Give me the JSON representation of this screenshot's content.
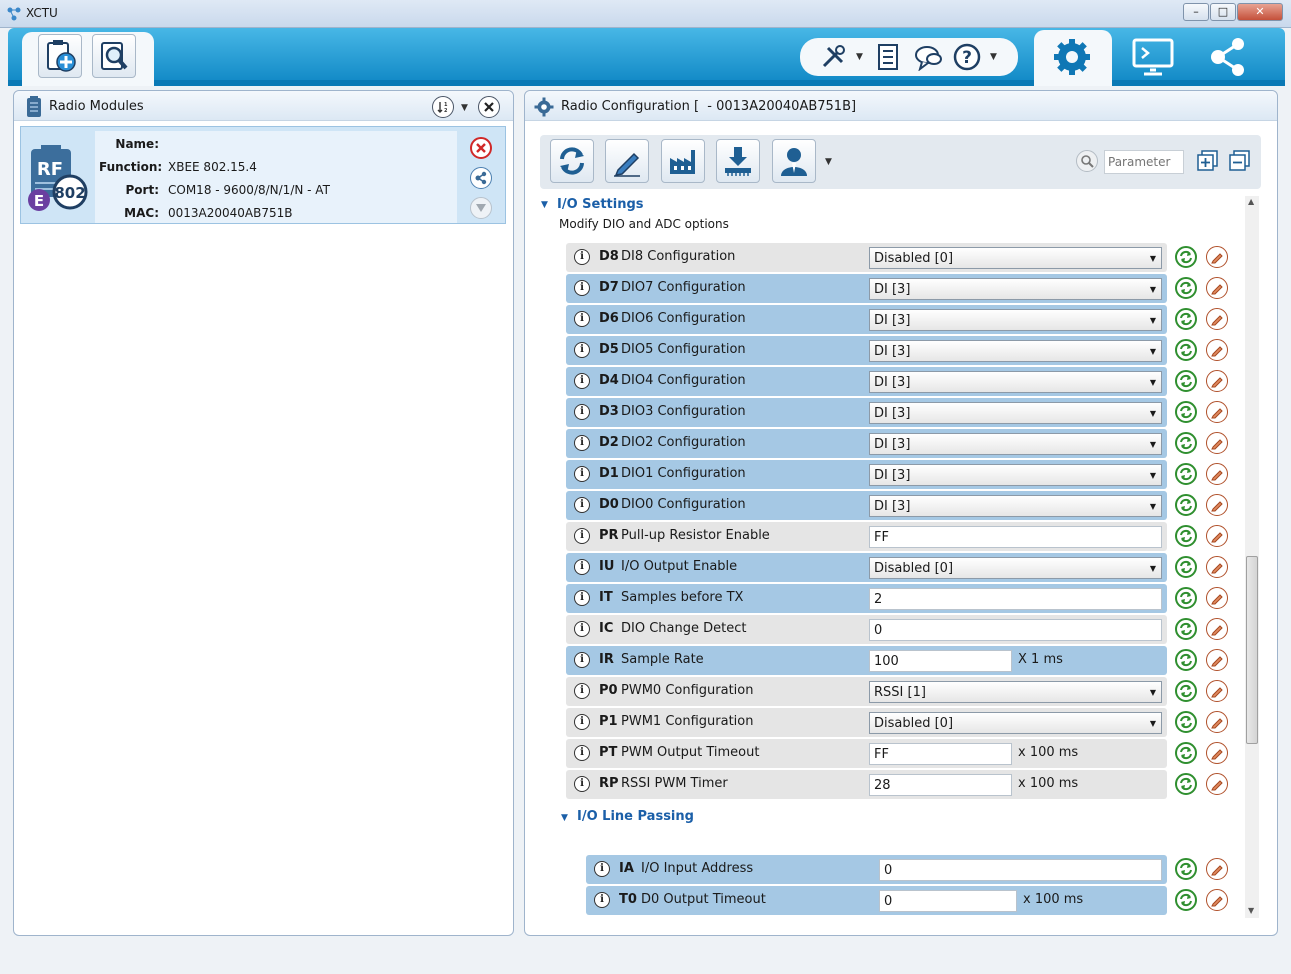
{
  "window": {
    "title": "XCTU"
  },
  "toolbar": {
    "search_placeholder": "Parameter"
  },
  "left_panel": {
    "title": "Radio Modules",
    "module": {
      "icon_text_top": "RF",
      "icon_text_badge": "802",
      "icon_text_e": "E",
      "name_label": "Name:",
      "name_value": "",
      "function_label": "Function:",
      "function_value": "XBEE 802.15.4",
      "port_label": "Port:",
      "port_value": "COM18 - 9600/8/N/1/N - AT",
      "mac_label": "MAC:",
      "mac_value": "0013A20040AB751B"
    }
  },
  "right_panel": {
    "title": "Radio Configuration [  - 0013A20040AB751B]",
    "section_title": "I/O Settings",
    "section_desc": "Modify DIO and ADC options",
    "subsection_title": "I/O Line Passing"
  },
  "params": [
    {
      "code": "D8",
      "name": "DI8 Configuration",
      "kind": "select",
      "value": "Disabled [0]",
      "unit": "",
      "color": "grey"
    },
    {
      "code": "D7",
      "name": "DIO7 Configuration",
      "kind": "select",
      "value": "DI [3]",
      "unit": "",
      "color": "blue"
    },
    {
      "code": "D6",
      "name": "DIO6 Configuration",
      "kind": "select",
      "value": "DI [3]",
      "unit": "",
      "color": "blue"
    },
    {
      "code": "D5",
      "name": "DIO5 Configuration",
      "kind": "select",
      "value": "DI [3]",
      "unit": "",
      "color": "blue"
    },
    {
      "code": "D4",
      "name": "DIO4 Configuration",
      "kind": "select",
      "value": "DI [3]",
      "unit": "",
      "color": "blue"
    },
    {
      "code": "D3",
      "name": "DIO3 Configuration",
      "kind": "select",
      "value": "DI [3]",
      "unit": "",
      "color": "blue"
    },
    {
      "code": "D2",
      "name": "DIO2 Configuration",
      "kind": "select",
      "value": "DI [3]",
      "unit": "",
      "color": "blue"
    },
    {
      "code": "D1",
      "name": "DIO1 Configuration",
      "kind": "select",
      "value": "DI [3]",
      "unit": "",
      "color": "blue"
    },
    {
      "code": "D0",
      "name": "DIO0 Configuration",
      "kind": "select",
      "value": "DI [3]",
      "unit": "",
      "color": "blue"
    },
    {
      "code": "PR",
      "name": "Pull-up Resistor Enable",
      "kind": "text",
      "value": "FF",
      "unit": "",
      "color": "grey"
    },
    {
      "code": "IU",
      "name": "I/O Output Enable",
      "kind": "select",
      "value": "Disabled [0]",
      "unit": "",
      "color": "blue"
    },
    {
      "code": "IT",
      "name": "Samples before TX",
      "kind": "text",
      "value": "2",
      "unit": "",
      "color": "blue"
    },
    {
      "code": "IC",
      "name": "DIO Change Detect",
      "kind": "text",
      "value": "0",
      "unit": "",
      "color": "grey"
    },
    {
      "code": "IR",
      "name": "Sample Rate",
      "kind": "short",
      "value": "100",
      "unit": "X 1 ms",
      "color": "blue"
    },
    {
      "code": "P0",
      "name": "PWM0 Configuration",
      "kind": "select",
      "value": "RSSI [1]",
      "unit": "",
      "color": "grey"
    },
    {
      "code": "P1",
      "name": "PWM1 Configuration",
      "kind": "select",
      "value": "Disabled [0]",
      "unit": "",
      "color": "grey"
    },
    {
      "code": "PT",
      "name": "PWM Output Timeout",
      "kind": "short",
      "value": "FF",
      "unit": "x 100 ms",
      "color": "grey"
    },
    {
      "code": "RP",
      "name": "RSSI PWM Timer",
      "kind": "short",
      "value": "28",
      "unit": "x 100 ms",
      "color": "grey"
    }
  ],
  "params2": [
    {
      "code": "IA",
      "name": "I/O Input Address",
      "kind": "text",
      "value": "0",
      "unit": "",
      "color": "blue"
    },
    {
      "code": "T0",
      "name": "D0 Output Timeout",
      "kind": "short",
      "value": "0",
      "unit": "x 100 ms",
      "color": "blue"
    }
  ],
  "icons": {
    "add_device": "add-device-icon",
    "discover": "discover-devices-icon",
    "tools": "tools-icon",
    "xctu_settings": "settings-list-icon",
    "feedback": "feedback-icon",
    "help": "help-icon",
    "config_mode": "gear-icon",
    "console_mode": "console-icon",
    "network_mode": "network-icon"
  },
  "colors": {
    "accent": "#1b87c6",
    "row_blue": "#a5c8e4",
    "row_grey": "#e5e5e5",
    "section": "#1b5fa8"
  }
}
